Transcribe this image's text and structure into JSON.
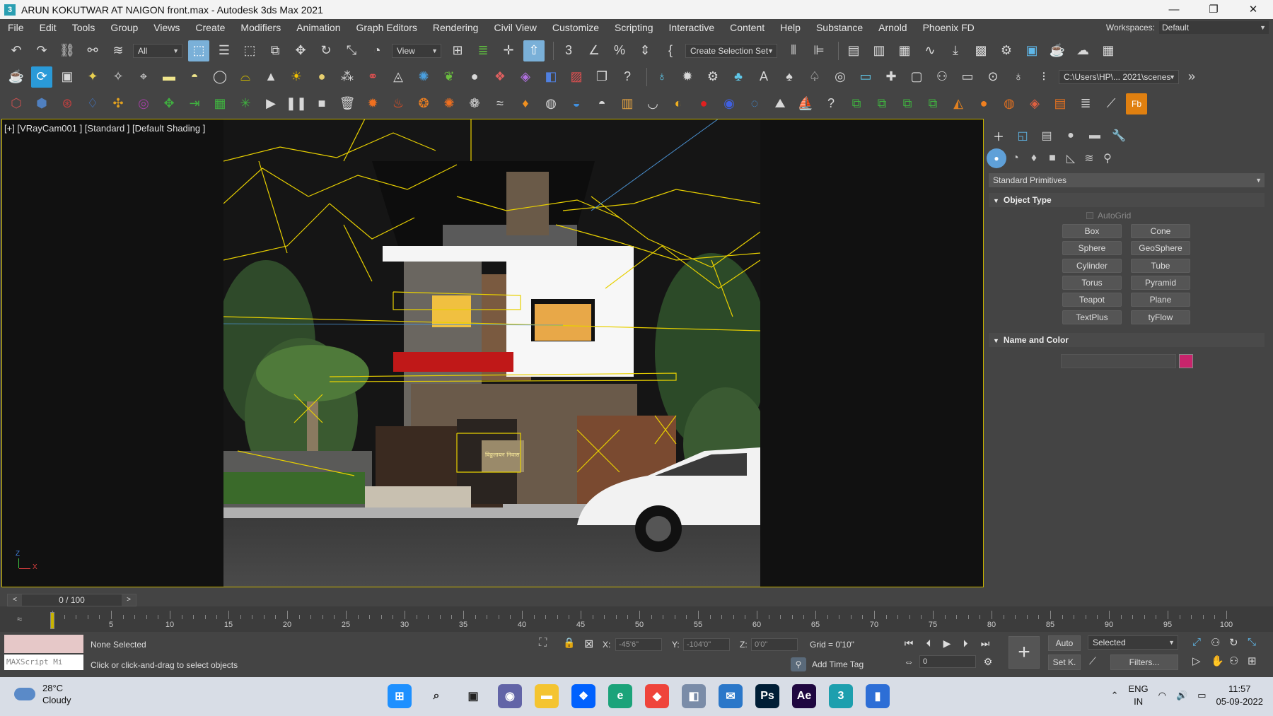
{
  "window": {
    "title": "ARUN KOKUTWAR AT NAIGON front.max - Autodesk 3ds Max 2021",
    "app_icon": "3",
    "minimize": "—",
    "maximize": "❐",
    "close": "✕"
  },
  "menu": {
    "items": [
      "File",
      "Edit",
      "Tools",
      "Group",
      "Views",
      "Create",
      "Modifiers",
      "Animation",
      "Graph Editors",
      "Rendering",
      "Civil View",
      "Customize",
      "Scripting",
      "Interactive",
      "Content",
      "Help",
      "Substance",
      "Arnold",
      "Phoenix FD"
    ],
    "workspaces_label": "Workspaces:",
    "workspace_value": "Default"
  },
  "toolbar1": {
    "selection_filter": "All",
    "reference_coord": "View",
    "named_selection": "Create Selection Set",
    "icons": [
      "undo-icon",
      "redo-icon",
      "link-icon",
      "unlink-icon",
      "bind-space-warp-icon",
      "select-object-icon",
      "select-by-name-icon",
      "rectangular-selection-icon",
      "window-crossing-icon",
      "move-icon",
      "rotate-icon",
      "scale-icon",
      "placement-icon",
      "pivot-center-icon",
      "select-manipulate-icon",
      "keyboard-shortcut-icon",
      "snaps-toggle-icon",
      "angle-snap-icon",
      "percent-snap-icon",
      "spinner-snap-icon",
      "edit-named-sets-icon",
      "mirror-icon",
      "align-icon",
      "layer-explorer-icon",
      "scene-explorer-icon",
      "toggle-ribbon-icon",
      "curve-editor-icon",
      "schematic-view-icon",
      "material-editor-icon",
      "render-setup-icon",
      "rendered-frame-icon",
      "render-icon",
      "render-cloud-icon",
      "a360-gallery-icon"
    ]
  },
  "toolbar2": {
    "project_path": "C:\\Users\\HP\\... 2021\\scenes",
    "icons": [
      "teapot-icon",
      "refresh-icon",
      "frame-icon",
      "light-lister-icon",
      "camera-icon",
      "rect-light-icon",
      "sphere-light-icon",
      "disc-light-icon",
      "dome-light-icon",
      "sun-icon",
      "ies-light-icon",
      "fur-icon",
      "proxy-icon",
      "plane-icon",
      "particles-icon",
      "plant-icon",
      "sphere-icon",
      "multi-icon",
      "material-icon",
      "viewport-icon",
      "bitmap-icon",
      "help-icon"
    ]
  },
  "toolbar3": {
    "icons": [
      "box-icon",
      "cube-icon",
      "torus-icon",
      "drop-icon",
      "swirl-icon",
      "circle-icon",
      "move-icon",
      "arrow-icon",
      "grid-icon",
      "star-icon",
      "play-icon",
      "pause-icon",
      "stop-icon",
      "trash-icon",
      "fire-icon",
      "fire2-icon",
      "smoke-icon",
      "flame-icon",
      "emitter-icon",
      "wind-icon",
      "drop2-icon",
      "vortex-icon",
      "liquid-icon",
      "foam-icon",
      "cup-icon",
      "bowl-icon",
      "sun2-icon",
      "red-ball-icon",
      "blue-ball-icon",
      "wave-icon",
      "ocean-icon",
      "boat-icon",
      "help2-icon",
      "select1-icon",
      "select2-icon",
      "select3-icon",
      "select4-icon",
      "orb-icon",
      "orange-ball-icon",
      "grid-ball-icon",
      "mixed-ball-icon",
      "brick-icon",
      "layers-icon",
      "brush-icon",
      "fb-icon"
    ]
  },
  "viewport": {
    "label": "[+] [VRayCam001 ] [Standard ] [Default Shading ]",
    "axis_y": "Z",
    "axis_x": "X",
    "gate_text": "विठ्ठलायन निवास"
  },
  "command_panel": {
    "tabs": [
      "create-tab-icon",
      "modify-tab-icon",
      "hierarchy-tab-icon",
      "motion-tab-icon",
      "display-tab-icon",
      "utilities-tab-icon"
    ],
    "subtabs": [
      "geometry-icon",
      "shapes-icon",
      "lights-icon",
      "cameras-icon",
      "helpers-icon",
      "space-warps-icon",
      "systems-icon"
    ],
    "category": "Standard Primitives",
    "object_type_header": "Object Type",
    "autogrid_label": "AutoGrid",
    "buttons": [
      "Box",
      "Cone",
      "Sphere",
      "GeoSphere",
      "Cylinder",
      "Tube",
      "Torus",
      "Pyramid",
      "Teapot",
      "Plane",
      "TextPlus",
      "tyFlow"
    ],
    "name_color_header": "Name and Color",
    "object_color": "#c8246c"
  },
  "timeline": {
    "time_slider": "0 / 100",
    "prev": "<",
    "next": ">",
    "tick_labels": [
      "5",
      "10",
      "15",
      "20",
      "25",
      "30",
      "35",
      "40",
      "45",
      "50",
      "55",
      "60",
      "65",
      "70",
      "75",
      "80",
      "85",
      "90",
      "95",
      "100"
    ],
    "current_frame": 0
  },
  "status": {
    "maxscript_placeholder": "MAXScript Mi",
    "selection_status": "None Selected",
    "prompt": "Click or click-and-drag to select objects",
    "x_label": "X:",
    "x_value": "-45'6\"",
    "y_label": "Y:",
    "y_value": "-104'0\"",
    "z_label": "Z:",
    "z_value": "0'0\"",
    "grid": "Grid = 0'10\"",
    "add_time_tag": "Add Time Tag",
    "auto_key": "Auto",
    "set_key": "Set K.",
    "key_filter_value": "Selected",
    "filters": "Filters...",
    "frame_spinner": "0"
  },
  "taskbar": {
    "temp": "28°C",
    "weather": "Cloudy",
    "lang_top": "ENG",
    "lang_bottom": "IN",
    "time": "11:57",
    "date": "05-09-2022",
    "apps": [
      {
        "name": "windows-start-icon",
        "color": "#1e90ff",
        "glyph": "⊞"
      },
      {
        "name": "search-icon",
        "color": "#d8dde6",
        "glyph": "⌕"
      },
      {
        "name": "task-view-icon",
        "color": "#d8dde6",
        "glyph": "▣"
      },
      {
        "name": "teams-chat-icon",
        "color": "#6264a7",
        "glyph": "◉"
      },
      {
        "name": "file-explorer-icon",
        "color": "#f4c430",
        "glyph": "▬"
      },
      {
        "name": "dropbox-icon",
        "color": "#0061fe",
        "glyph": "❖"
      },
      {
        "name": "edge-icon",
        "color": "#1ba37a",
        "glyph": "e"
      },
      {
        "name": "anydesk-icon",
        "color": "#ef443b",
        "glyph": "◆"
      },
      {
        "name": "photos-icon",
        "color": "#7a8ca8",
        "glyph": "◧"
      },
      {
        "name": "mail-icon",
        "color": "#2a77c9",
        "glyph": "✉"
      },
      {
        "name": "photoshop-icon",
        "color": "#001e36",
        "glyph": "Ps"
      },
      {
        "name": "after-effects-icon",
        "color": "#1f0740",
        "glyph": "Ae"
      },
      {
        "name": "3dsmax-icon",
        "color": "#1d9fae",
        "glyph": "3"
      },
      {
        "name": "generic-app-icon",
        "color": "#2d6ed6",
        "glyph": "▮"
      }
    ]
  }
}
